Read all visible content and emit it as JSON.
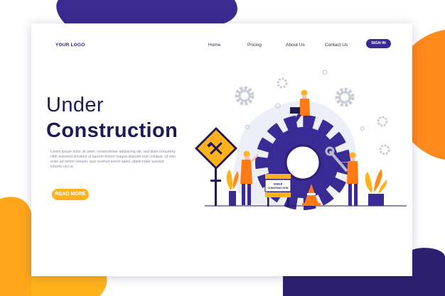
{
  "header": {
    "logo": "YOUR LOGO",
    "nav": [
      "Home",
      "Pricing",
      "About Us",
      "Contact Us"
    ],
    "sign_in": "SIGN IN"
  },
  "hero": {
    "title_line1": "Under",
    "title_line2": "Construction",
    "body": "Lorem ipsum dolor sit amet, consectetuer adipiscing elit, sed diam nonummy nibh euismod tincidunt ut laoreet dolore magna aliquam erat volutpat. Ut wisi enim ad minim veniam, quis nostrud exerci tation ullamcorper suscipit lobortis nisl ut",
    "cta": "READ MORE"
  },
  "illustration": {
    "sign_line1": "UNDER",
    "sign_line2": "CONSTRUCTION"
  },
  "colors": {
    "primary": "#3a2a96",
    "navy": "#1e1a55",
    "accent": "#ffb21a",
    "orange": "#ff7a12"
  },
  "icons": [
    "gear-icon",
    "hammer-wrench-icon",
    "wrench-icon",
    "traffic-cone-icon",
    "plant-icon"
  ]
}
